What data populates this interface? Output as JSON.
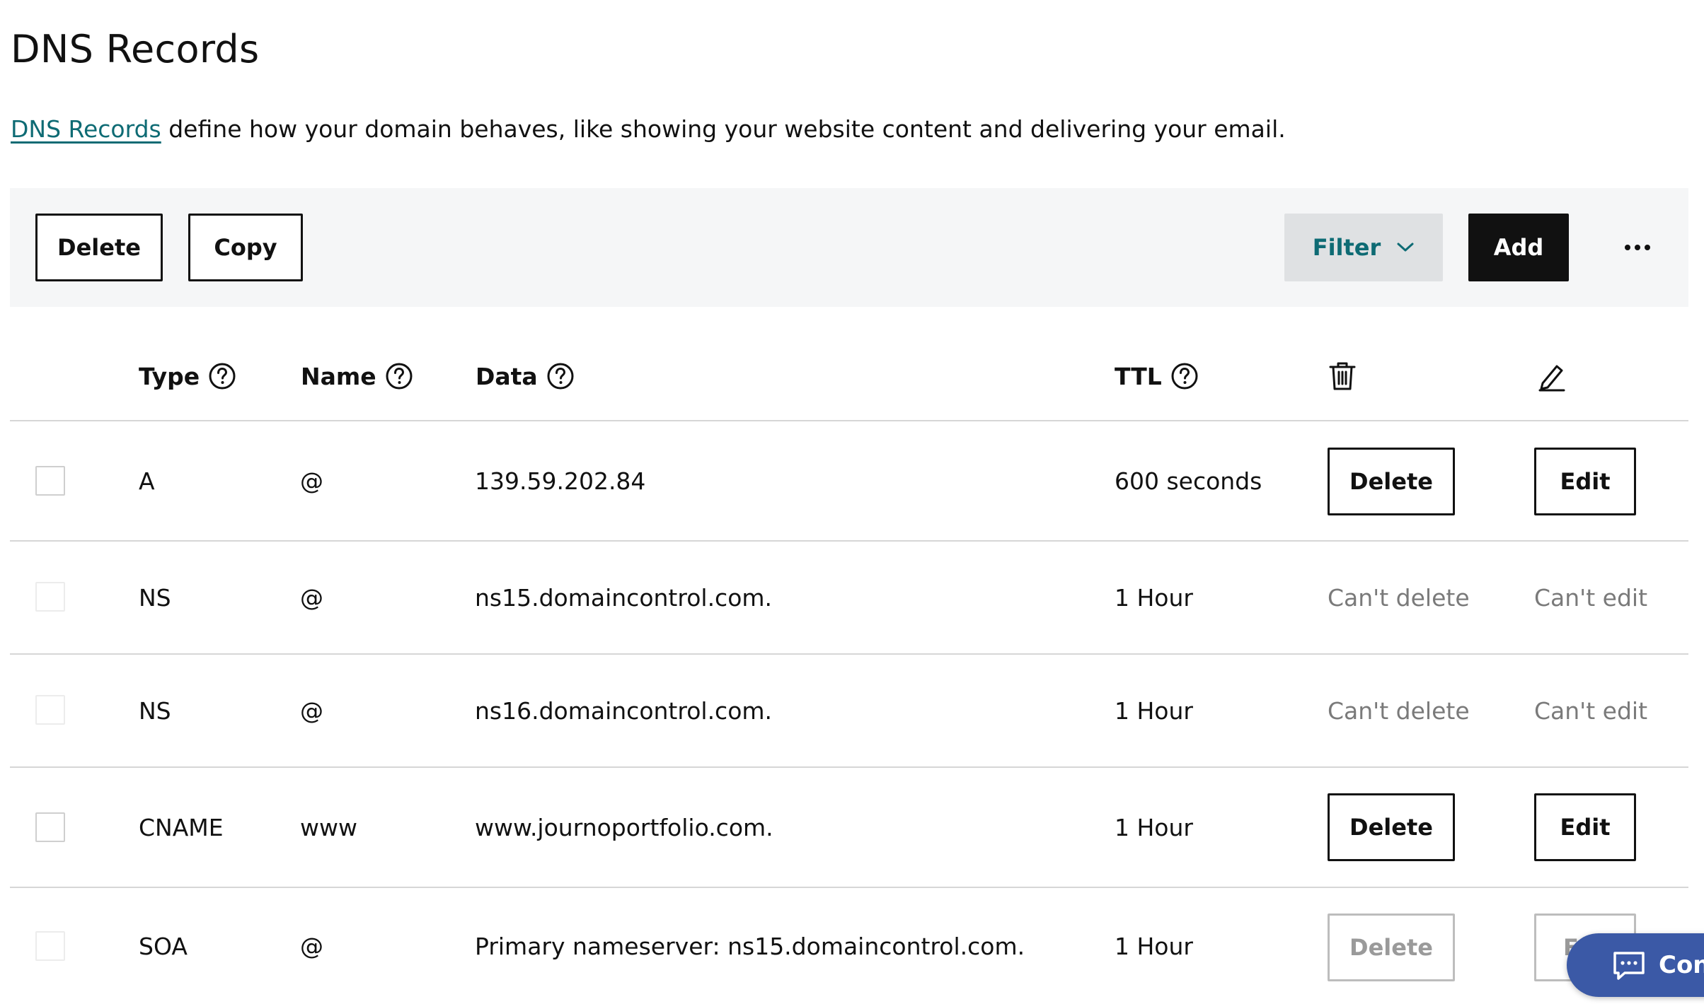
{
  "page": {
    "title": "DNS Records",
    "description_link": "DNS Records",
    "description_rest": " define how your domain behaves, like showing your website content and delivering your email."
  },
  "toolbar": {
    "delete_label": "Delete",
    "copy_label": "Copy",
    "filter_label": "Filter",
    "add_label": "Add"
  },
  "table": {
    "headers": {
      "type": "Type",
      "name": "Name",
      "data": "Data",
      "ttl": "TTL"
    },
    "rows": [
      {
        "type": "A",
        "name": "@",
        "data": "139.59.202.84",
        "ttl": "600 seconds",
        "delete": "Delete",
        "edit": "Edit"
      },
      {
        "type": "NS",
        "name": "@",
        "data": "ns15.domaincontrol.com.",
        "ttl": "1 Hour",
        "delete": "Can't delete",
        "edit": "Can't edit"
      },
      {
        "type": "NS",
        "name": "@",
        "data": "ns16.domaincontrol.com.",
        "ttl": "1 Hour",
        "delete": "Can't delete",
        "edit": "Can't edit"
      },
      {
        "type": "CNAME",
        "name": "www",
        "data": "www.journoportfolio.com.",
        "ttl": "1 Hour",
        "delete": "Delete",
        "edit": "Edit"
      },
      {
        "type": "SOA",
        "name": "@",
        "data": "Primary nameserver: ns15.domaincontrol.com.",
        "ttl": "1 Hour",
        "delete": "Delete",
        "edit": "E"
      }
    ]
  },
  "chat": {
    "label": "Con"
  },
  "colors": {
    "link": "#0e6b74",
    "toolbar_bg": "#f5f6f7",
    "filter_bg": "#dfe1e3",
    "add_bg": "#111111",
    "chat_bg": "#3b59a6",
    "muted_text": "#7a7a7a"
  },
  "icons": {
    "help": "question-circle-icon",
    "trash": "trash-icon",
    "edit": "pencil-icon",
    "more": "more-horizontal-icon",
    "filter": "chevron-down-icon",
    "chat": "chat-bubble-icon"
  }
}
